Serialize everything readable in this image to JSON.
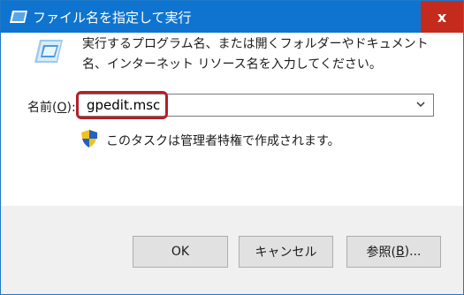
{
  "window": {
    "title": "ファイル名を指定して実行",
    "close_label": "x"
  },
  "content": {
    "description": "実行するプログラム名、または開くフォルダーやドキュメント名、インターネット リソース名を入力してください。",
    "name_label_prefix": "名前(",
    "name_label_accel": "O",
    "name_label_suffix": "):",
    "input_value": "gpedit.msc",
    "admin_note": "このタスクは管理者特権で作成されます。"
  },
  "buttons": {
    "ok_label": "OK",
    "cancel_label": "キャンセル",
    "browse_prefix": "参照(",
    "browse_accel": "B",
    "browse_suffix": ")..."
  },
  "icons": {
    "title": "run-dialog-icon",
    "run": "run-program-icon",
    "dropdown": "chevron-down-icon",
    "admin": "uac-shield-icon"
  },
  "colors": {
    "titlebar": "#0f74cf",
    "close": "#c42b1c",
    "highlight": "#b22029"
  }
}
